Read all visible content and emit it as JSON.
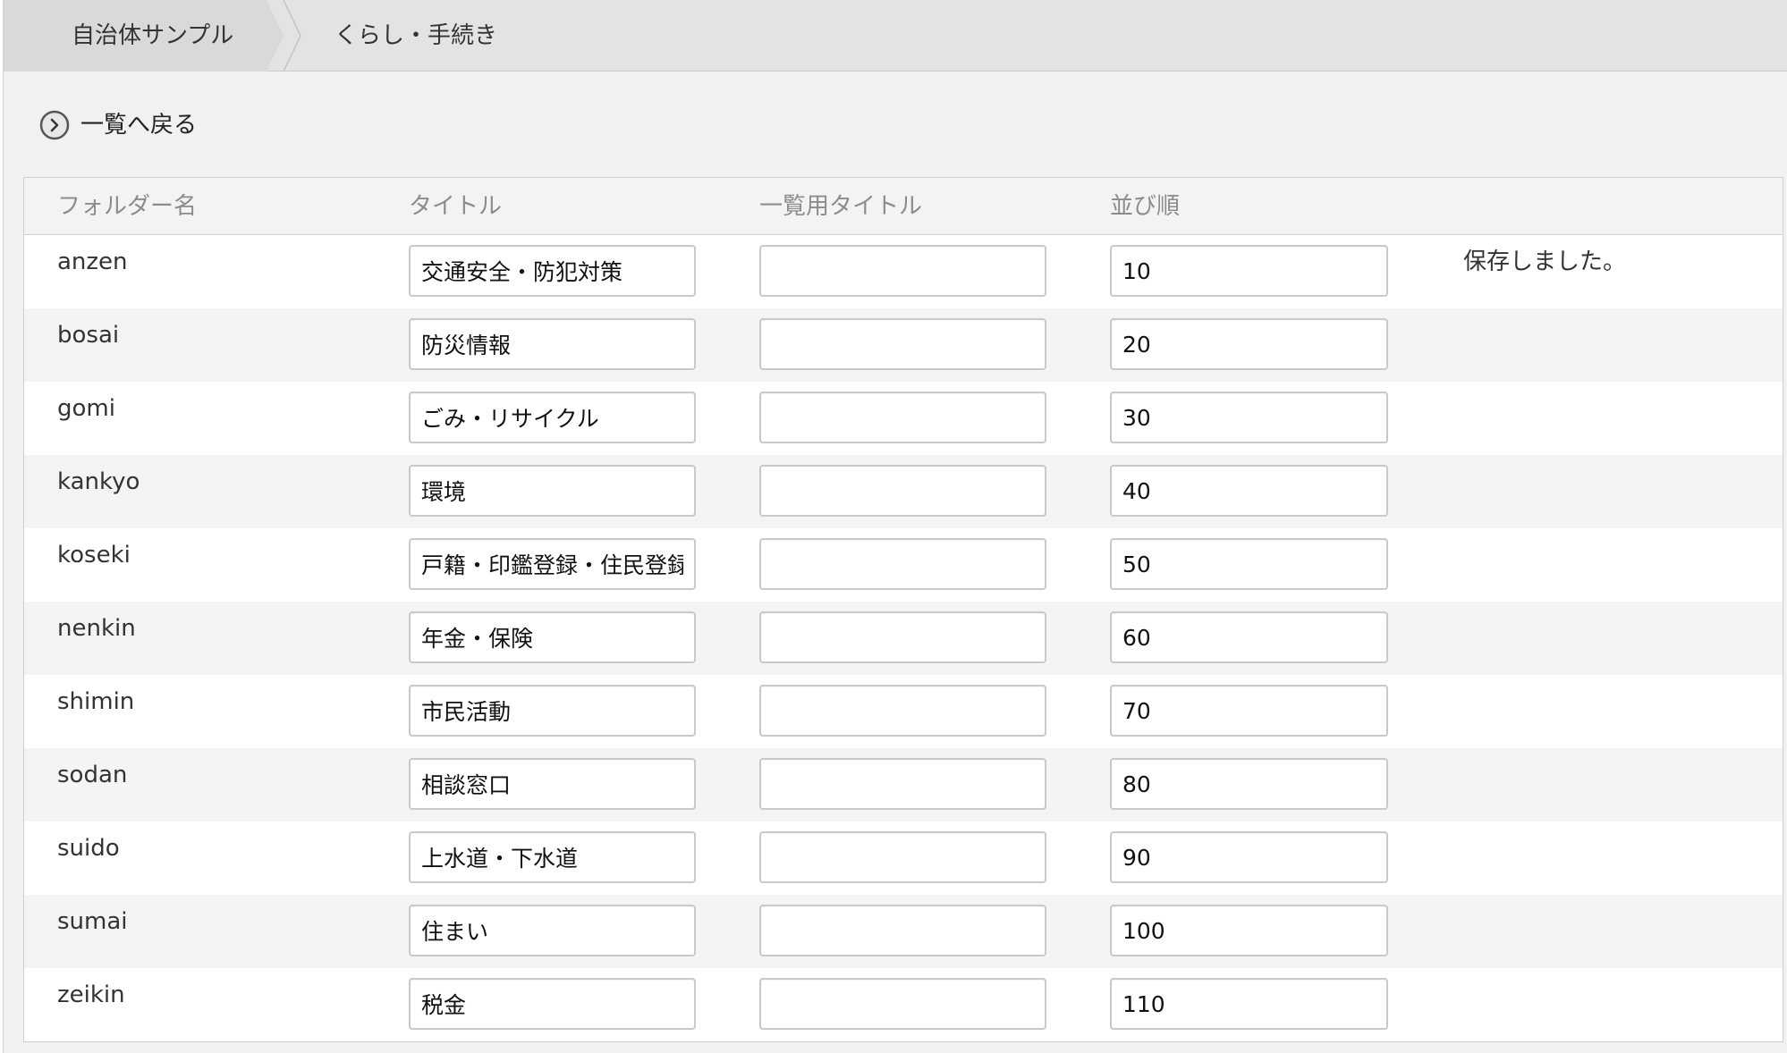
{
  "breadcrumb": {
    "items": [
      "自治体サンプル",
      "くらし・手続き"
    ]
  },
  "back_link": {
    "label": "一覧へ戻る",
    "icon": "chevron-right-circle-icon"
  },
  "table": {
    "headers": [
      "フォルダー名",
      "タイトル",
      "一覧用タイトル",
      "並び順"
    ],
    "rows": [
      {
        "folder": "anzen",
        "title": "交通安全・防犯対策",
        "list_title": "",
        "sort": "10",
        "status": "保存しました。"
      },
      {
        "folder": "bosai",
        "title": "防災情報",
        "list_title": "",
        "sort": "20",
        "status": ""
      },
      {
        "folder": "gomi",
        "title": "ごみ・リサイクル",
        "list_title": "",
        "sort": "30",
        "status": ""
      },
      {
        "folder": "kankyo",
        "title": "環境",
        "list_title": "",
        "sort": "40",
        "status": ""
      },
      {
        "folder": "koseki",
        "title": "戸籍・印鑑登録・住民登録",
        "list_title": "",
        "sort": "50",
        "status": ""
      },
      {
        "folder": "nenkin",
        "title": "年金・保険",
        "list_title": "",
        "sort": "60",
        "status": ""
      },
      {
        "folder": "shimin",
        "title": "市民活動",
        "list_title": "",
        "sort": "70",
        "status": ""
      },
      {
        "folder": "sodan",
        "title": "相談窓口",
        "list_title": "",
        "sort": "80",
        "status": ""
      },
      {
        "folder": "suido",
        "title": "上水道・下水道",
        "list_title": "",
        "sort": "90",
        "status": ""
      },
      {
        "folder": "sumai",
        "title": "住まい",
        "list_title": "",
        "sort": "100",
        "status": ""
      },
      {
        "folder": "zeikin",
        "title": "税金",
        "list_title": "",
        "sort": "110",
        "status": ""
      }
    ]
  },
  "colors": {
    "background": "#f1f1f1",
    "breadcrumb_bar": "#e3e3e3",
    "row_alt": "#f4f4f4",
    "header_text": "#8c8c8c"
  }
}
